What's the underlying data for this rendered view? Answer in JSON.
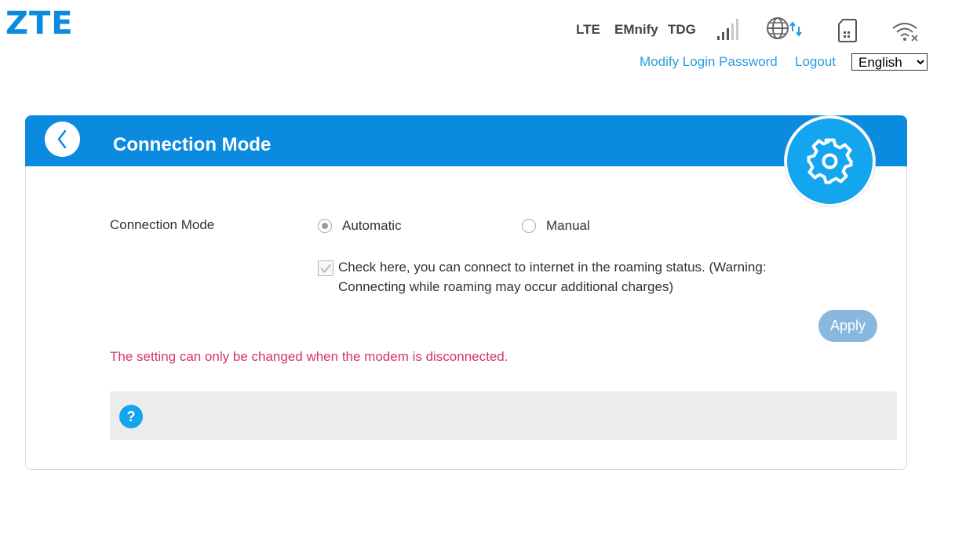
{
  "brand": {
    "logo_text": "ZTE",
    "accent": "#0b8be0"
  },
  "status_bar": {
    "network_type": "LTE",
    "operator": "EMnify",
    "operator2": "TDG",
    "icons": [
      "signal-strength-icon",
      "internet-globe-icon",
      "sim-card-icon",
      "wifi-off-icon"
    ]
  },
  "header_links": {
    "modify_password": "Modify Login Password",
    "logout": "Logout",
    "language_selected": "English"
  },
  "page": {
    "title": "Connection Mode",
    "field_label": "Connection Mode",
    "options": [
      {
        "label": "Automatic",
        "selected": true
      },
      {
        "label": "Manual",
        "selected": false
      }
    ],
    "roaming_text": "Check here, you can connect to internet in the roaming status. (Warning: Connecting while roaming may occur additional charges)",
    "apply_label": "Apply",
    "warning_text": "The setting can only be changed when the modem is disconnected.",
    "warning_color": "#d6336c",
    "help_symbol": "?"
  }
}
